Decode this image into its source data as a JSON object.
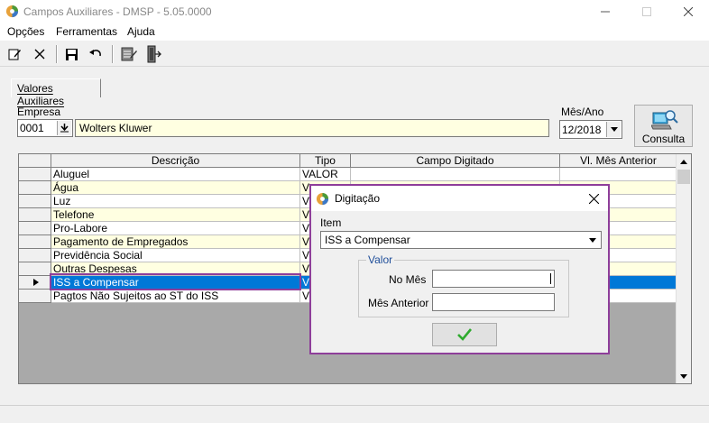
{
  "window": {
    "title": "Campos Auxiliares - DMSP - 5.05.0000",
    "icon": "app-logo-icon"
  },
  "menu": {
    "items": [
      "Opções",
      "Ferramentas",
      "Ajuda"
    ]
  },
  "toolbar": {
    "icons": [
      "edit-icon",
      "delete-icon",
      "save-icon",
      "undo-icon",
      "notepad-icon",
      "exit-door-icon"
    ]
  },
  "tab": {
    "label": "Valores Auxiliares"
  },
  "filters": {
    "empresa_label": "Empresa",
    "empresa_code": "0001",
    "empresa_name": "Wolters Kluwer",
    "mesano_label": "Mês/Ano",
    "mesano_value": "12/2018",
    "consulta_label": "Consulta"
  },
  "grid": {
    "columns": [
      "Descrição",
      "Tipo",
      "Campo Digitado",
      "Vl. Mês Anterior"
    ],
    "rows": [
      {
        "descricao": "Aluguel",
        "tipo": "VALOR",
        "campo": "",
        "anterior": ""
      },
      {
        "descricao": "Água",
        "tipo": "V",
        "campo": "",
        "anterior": ""
      },
      {
        "descricao": "Luz",
        "tipo": "V",
        "campo": "",
        "anterior": ""
      },
      {
        "descricao": "Telefone",
        "tipo": "V",
        "campo": "",
        "anterior": ""
      },
      {
        "descricao": "Pro-Labore",
        "tipo": "V",
        "campo": "",
        "anterior": ""
      },
      {
        "descricao": "Pagamento de Empregados",
        "tipo": "V",
        "campo": "",
        "anterior": ""
      },
      {
        "descricao": "Previdência Social",
        "tipo": "V",
        "campo": "",
        "anterior": ""
      },
      {
        "descricao": "Outras Despesas",
        "tipo": "V",
        "campo": "",
        "anterior": ""
      },
      {
        "descricao": "ISS a Compensar",
        "tipo": "V",
        "campo": "",
        "anterior": ""
      },
      {
        "descricao": "Pagtos Não Sujeitos ao ST do ISS",
        "tipo": "V",
        "campo": "",
        "anterior": ""
      }
    ],
    "selected_index": 8
  },
  "dialog": {
    "title": "Digitação",
    "item_label": "Item",
    "item_value": "ISS a Compensar",
    "group_label": "Valor",
    "no_mes_label": "No Mês",
    "no_mes_value": "",
    "mes_anterior_label": "Mês Anterior",
    "mes_anterior_value": "",
    "ok_icon": "checkmark-icon"
  },
  "colors": {
    "highlight": "#8e3e9a",
    "selection": "#0078d7",
    "row_alt": "#ffffe1",
    "check": "#2eaa2e"
  }
}
